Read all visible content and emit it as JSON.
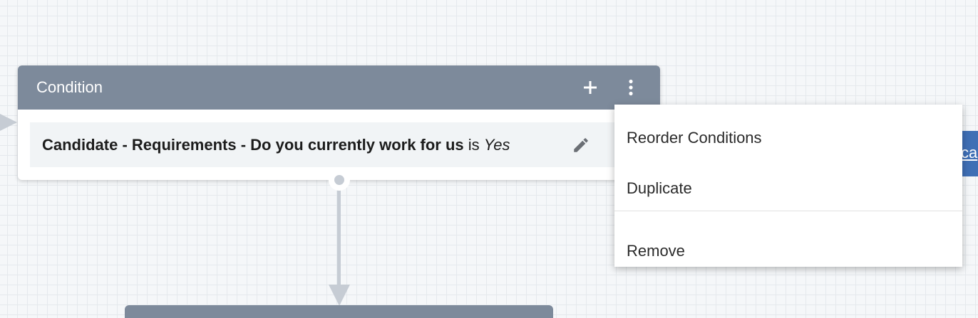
{
  "node": {
    "title": "Condition",
    "add_icon": "plus-icon",
    "more_icon": "more-vertical-icon",
    "condition": {
      "field": "Candidate - Requirements - Do you currently work for us",
      "operator": "is",
      "value": "Yes",
      "edit_icon": "pencil-icon"
    }
  },
  "side_node": {
    "link_text": "ca"
  },
  "menu": {
    "items": [
      {
        "label": "Reorder Conditions"
      },
      {
        "label": "Duplicate"
      },
      {
        "label": "Remove"
      }
    ]
  },
  "colors": {
    "node_header": "#7d8a9b",
    "condition_row": "#f1f4f6",
    "connector": "#c6ccd4",
    "side_node": "#3f6fb5",
    "canvas": "#f5f7f9"
  }
}
